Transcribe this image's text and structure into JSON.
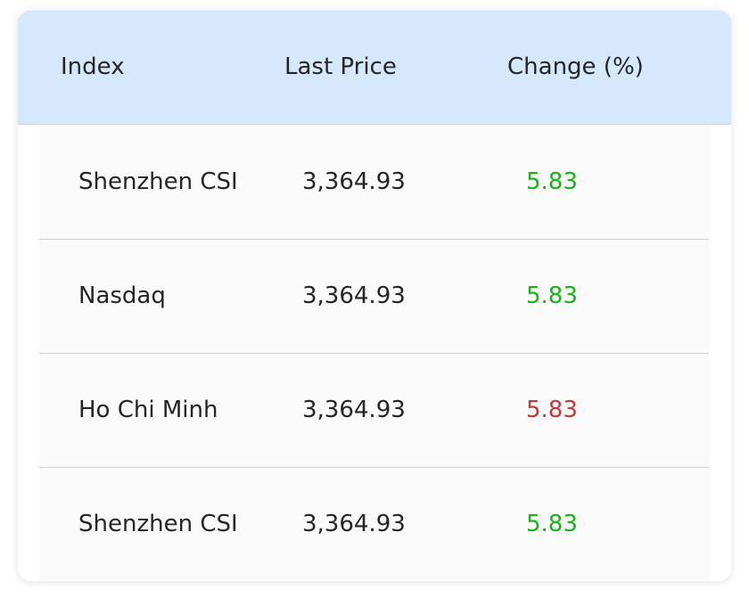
{
  "table": {
    "headers": [
      "Index",
      "Last Price",
      "Change (%)"
    ],
    "rows": [
      {
        "index": "Shenzhen CSI",
        "last_price": "3,364.93",
        "change": "5.83",
        "direction": "up"
      },
      {
        "index": "Nasdaq",
        "last_price": "3,364.93",
        "change": "5.83",
        "direction": "up"
      },
      {
        "index": "Ho Chi Minh",
        "last_price": "3,364.93",
        "change": "5.83",
        "direction": "down"
      },
      {
        "index": "Shenzhen CSI",
        "last_price": "3,364.93",
        "change": "5.83",
        "direction": "up"
      }
    ]
  },
  "colors": {
    "header_bg": "#d6e8fb",
    "positive": "#16b416",
    "negative": "#c0393b"
  }
}
